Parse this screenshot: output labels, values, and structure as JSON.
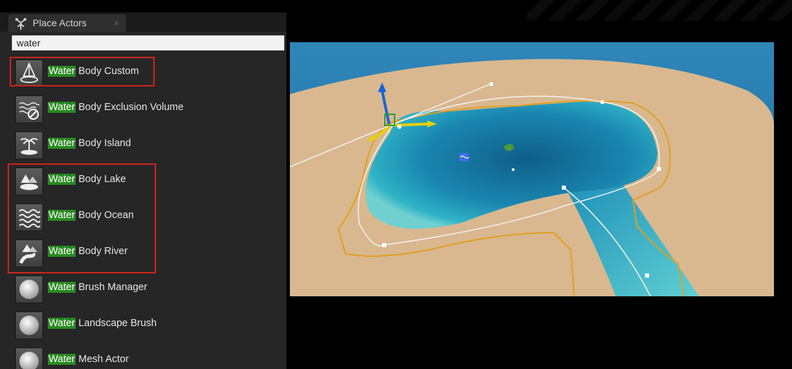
{
  "panel": {
    "tab": {
      "title": "Place Actors",
      "close": "×"
    },
    "search": {
      "value": "water"
    },
    "items": [
      {
        "highlight": "Water",
        "rest": "Body Custom",
        "icon": "water-body-custom-icon"
      },
      {
        "highlight": "Water",
        "rest": "Body Exclusion Volume",
        "icon": "water-body-exclusion-volume-icon"
      },
      {
        "highlight": "Water",
        "rest": "Body Island",
        "icon": "water-body-island-icon"
      },
      {
        "highlight": "Water",
        "rest": "Body Lake",
        "icon": "water-body-lake-icon"
      },
      {
        "highlight": "Water",
        "rest": "Body Ocean",
        "icon": "water-body-ocean-icon"
      },
      {
        "highlight": "Water",
        "rest": "Body River",
        "icon": "water-body-river-icon"
      },
      {
        "highlight": "Water",
        "rest": "Brush Manager",
        "icon": "sphere-icon"
      },
      {
        "highlight": "Water",
        "rest": "Landscape Brush",
        "icon": "sphere-icon"
      },
      {
        "highlight": "Water",
        "rest": "Mesh Actor",
        "icon": "sphere-icon"
      }
    ]
  },
  "viewport": {
    "scene": "water-lake-river-scene"
  },
  "colors": {
    "highlight": "#2a8a22",
    "annotation": "#d0241c",
    "sand": "#d8b78f",
    "water": "#1f8db5",
    "spline": "#e0a020"
  }
}
